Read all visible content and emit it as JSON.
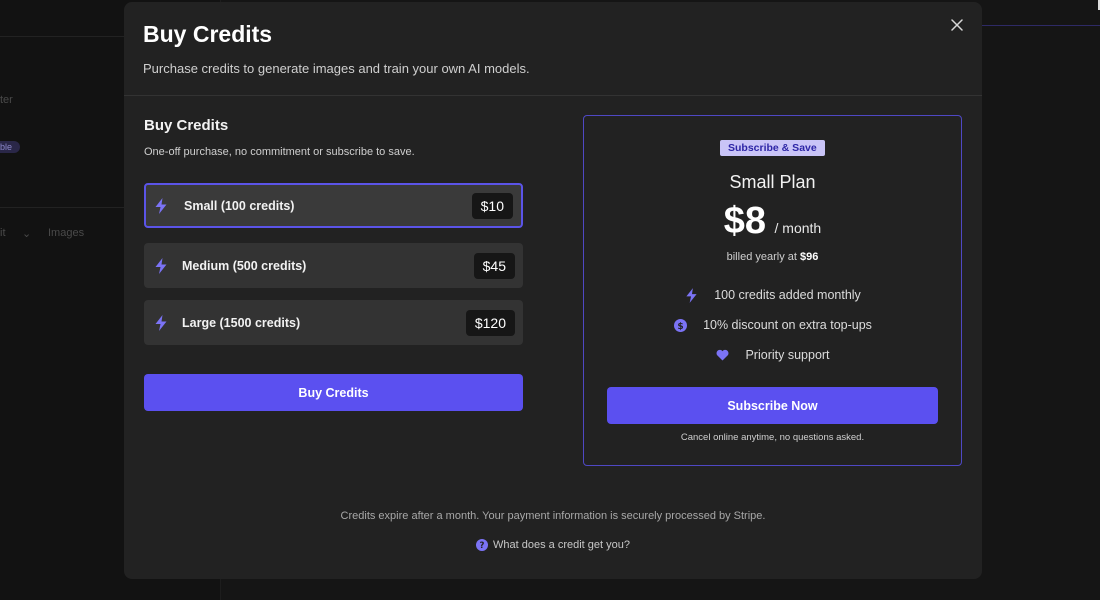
{
  "background": {
    "sidebar_text_1": "ter",
    "sidebar_badge": "ble",
    "sidebar_text_2": "it",
    "sidebar_text_3": "Images"
  },
  "modal": {
    "title": "Buy Credits",
    "subtitle": "Purchase credits to generate images and train your own AI models.",
    "close_icon": "close-icon"
  },
  "one_off": {
    "title": "Buy Credits",
    "description": "One-off purchase, no commitment or subscribe to save.",
    "options": [
      {
        "label": "Small (100 credits)",
        "price": "$10",
        "selected": true,
        "icon": "lightning-icon"
      },
      {
        "label": "Medium (500 credits)",
        "price": "$45",
        "selected": false,
        "icon": "lightning-icon"
      },
      {
        "label": "Large (1500 credits)",
        "price": "$120",
        "selected": false,
        "icon": "lightning-icon"
      }
    ],
    "buy_button": "Buy Credits"
  },
  "plan": {
    "badge": "Subscribe & Save",
    "name": "Small Plan",
    "price": "$8",
    "period": "/ month",
    "billing_prefix": "billed yearly at",
    "billing_amount": "$96",
    "features": [
      {
        "icon": "lightning-icon",
        "text": "100 credits added monthly"
      },
      {
        "icon": "dollar-coin-icon",
        "text": "10% discount on extra top-ups"
      },
      {
        "icon": "heart-icon",
        "text": "Priority support"
      }
    ],
    "subscribe_button": "Subscribe Now",
    "cancel_note": "Cancel online anytime, no questions asked."
  },
  "footer": {
    "note": "Credits expire after a month. Your payment information is securely processed by Stripe.",
    "help_link": "What does a credit get you?"
  },
  "colors": {
    "accent": "#5b50f0",
    "accent_icon": "#7b73f5",
    "modal_bg": "#222222",
    "page_bg": "#151515",
    "badge_bg": "#c9c4f7"
  }
}
